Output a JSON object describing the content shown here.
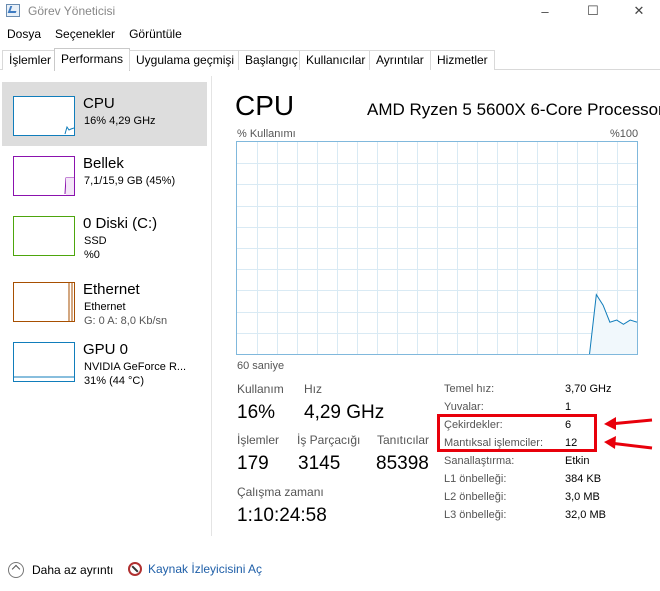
{
  "window": {
    "title": "Görev Yöneticisi",
    "minimize_glyph": "–",
    "maximize_glyph": "☐",
    "close_glyph": "✕"
  },
  "menu": [
    "Dosya",
    "Seçenekler",
    "Görüntüle"
  ],
  "tabs": [
    {
      "label": "İşlemler",
      "active": false
    },
    {
      "label": "Performans",
      "active": true
    },
    {
      "label": "Uygulama geçmişi",
      "active": false
    },
    {
      "label": "Başlangıç",
      "active": false
    },
    {
      "label": "Kullanıcılar",
      "active": false
    },
    {
      "label": "Ayrıntılar",
      "active": false
    },
    {
      "label": "Hizmetler",
      "active": false
    }
  ],
  "devices": [
    {
      "name": "CPU",
      "line1": "16% 4,29 GHz",
      "line2": "",
      "color": "#117dbb",
      "selected": true
    },
    {
      "name": "Bellek",
      "line1": "7,1/15,9 GB (45%)",
      "line2": "",
      "color": "#8b12ae",
      "selected": false
    },
    {
      "name": "0 Diski (C:)",
      "line1": "SSD",
      "line2": "%0",
      "color": "#4da60c",
      "selected": false
    },
    {
      "name": "Ethernet",
      "line1": "Ethernet",
      "line2": "G: 0 A: 8,0 Kb/sn",
      "color": "#a74f01",
      "selected": false
    },
    {
      "name": "GPU 0",
      "line1": "NVIDIA GeForce R...",
      "line2": "31% (44 °C)",
      "color": "#117dbb",
      "selected": false
    }
  ],
  "cpu": {
    "title": "CPU",
    "model": "AMD Ryzen 5 5600X 6-Core Processor",
    "graph_label_left": "% Kullanımı",
    "graph_label_right": "%100",
    "graph_time_label": "60 saniye",
    "usage_history_pct": [
      0,
      0,
      0,
      0,
      0,
      0,
      0,
      0,
      0,
      0,
      0,
      0,
      0,
      0,
      0,
      0,
      0,
      0,
      0,
      0,
      0,
      0,
      0,
      0,
      0,
      0,
      0,
      0,
      0,
      0,
      0,
      0,
      0,
      0,
      0,
      0,
      0,
      0,
      0,
      0,
      0,
      0,
      0,
      0,
      0,
      0,
      0,
      0,
      0,
      0,
      0,
      0,
      0,
      28,
      23,
      15,
      16,
      14,
      16,
      15
    ],
    "stats": [
      {
        "label": "Kullanım",
        "value": "16%"
      },
      {
        "label": "Hız",
        "value": "4,29 GHz"
      },
      {
        "label": "İşlemler",
        "value": "179"
      },
      {
        "label": "İş Parçacığı",
        "value": "3145"
      },
      {
        "label": "Tanıtıcılar",
        "value": "85398"
      },
      {
        "label": "Çalışma zamanı",
        "value": "1:10:24:58"
      }
    ],
    "specs": [
      {
        "label": "Temel hız:",
        "value": "3,70 GHz"
      },
      {
        "label": "Yuvalar:",
        "value": "1"
      },
      {
        "label": "Çekirdekler:",
        "value": "6"
      },
      {
        "label": "Mantıksal işlemciler:",
        "value": "12"
      },
      {
        "label": "Sanallaştırma:",
        "value": "Etkin"
      },
      {
        "label": "L1 önbelleği:",
        "value": "384 KB"
      },
      {
        "label": "L2 önbelleği:",
        "value": "3,0 MB"
      },
      {
        "label": "L3 önbelleği:",
        "value": "32,0 MB"
      }
    ]
  },
  "footer": {
    "fewer_details": "Daha az ayrıntı",
    "resource_monitor": "Kaynak İzleyicisini Aç"
  },
  "colors": {
    "cpu_line": "#117dbb",
    "graph_grid": "#d9eaf4",
    "annotation": "#e8000b"
  }
}
